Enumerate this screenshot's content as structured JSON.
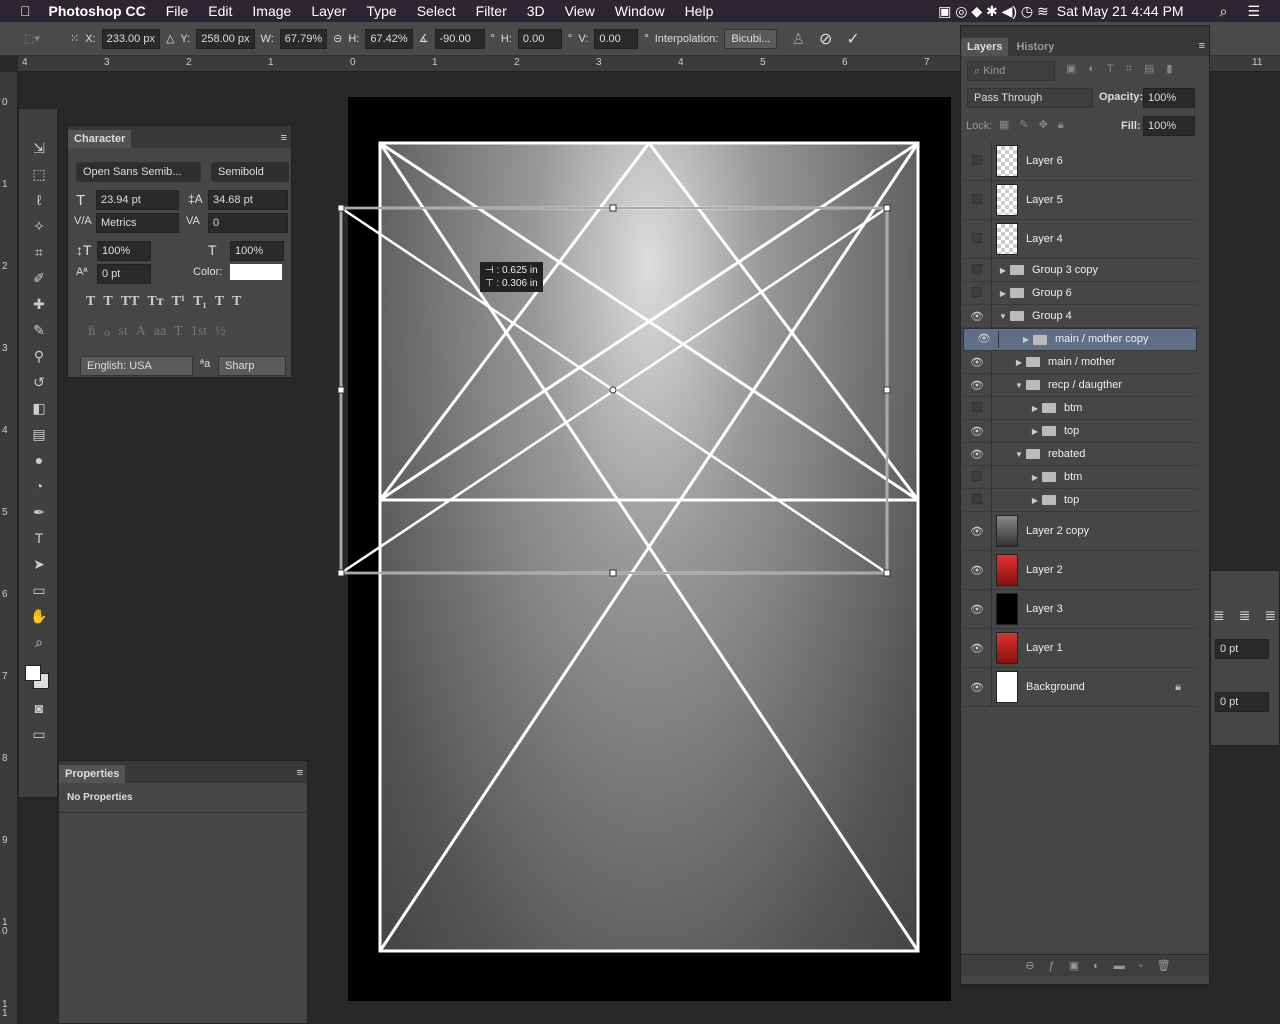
{
  "menubar": {
    "app": "Photoshop CC",
    "items": [
      "File",
      "Edit",
      "Image",
      "Layer",
      "Type",
      "Select",
      "Filter",
      "3D",
      "View",
      "Window",
      "Help"
    ],
    "clock": "Sat May 21  4:44 PM"
  },
  "options": {
    "x_label": "X:",
    "x": "233.00 px",
    "y_label": "Y:",
    "y": "258.00 px",
    "w_label": "W:",
    "w": "67.79%",
    "h_label": "H:",
    "h": "67.42%",
    "angle": "-90.00",
    "hskew_label": "H:",
    "hskew": "0.00",
    "vskew_label": "V:",
    "vskew": "0.00",
    "deg": "°",
    "interp_label": "Interpolation:",
    "interp": "Bicubi..."
  },
  "ruler": {
    "h": [
      "4",
      "3",
      "2",
      "1",
      "0",
      "1",
      "2",
      "3",
      "4",
      "5",
      "6",
      "7"
    ],
    "h_right": "11",
    "v": [
      "0",
      "1",
      "2",
      "3",
      "4",
      "5",
      "6",
      "7",
      "8",
      "9",
      "1\n0",
      "1\n1"
    ]
  },
  "character": {
    "tab": "Character",
    "font": "Open Sans Semib...",
    "style": "Semibold",
    "size": "23.94 pt",
    "leading": "34.68 pt",
    "kerning": "Metrics",
    "tracking": "0",
    "vscale": "100%",
    "hscale": "100%",
    "baseline": "0 pt",
    "color_label": "Color:",
    "color": "#ffffff",
    "styles": [
      "T",
      "T",
      "TT",
      "Tт",
      "T¹",
      "T₁",
      "T",
      "T"
    ],
    "opentype": [
      "ﬁ",
      "ℴ",
      "st",
      "A",
      "aa",
      "T",
      "1st",
      "½"
    ],
    "language": "English: USA",
    "aa_icon": "ªa",
    "antialias": "Sharp"
  },
  "properties": {
    "tab": "Properties",
    "text": "No Properties"
  },
  "tooltip": {
    "line1": "⊣ : 0.625 in",
    "line2": "⊤ : 0.306 in"
  },
  "layers": {
    "tab": "Layers",
    "tab2": "History",
    "kind": "Kind",
    "blend": "Pass Through",
    "opacity_label": "Opacity:",
    "opacity": "100%",
    "lock_label": "Lock:",
    "fill_label": "Fill:",
    "fill": "100%",
    "rows": [
      {
        "name": "Layer 6",
        "visible": false,
        "type": "layer",
        "thumb": "trans",
        "depth": 0
      },
      {
        "name": "Layer 5",
        "visible": false,
        "type": "layer",
        "thumb": "trans",
        "depth": 0
      },
      {
        "name": "Layer 4",
        "visible": false,
        "type": "layer",
        "thumb": "trans",
        "depth": 0
      },
      {
        "name": "Group 3 copy",
        "visible": false,
        "type": "group",
        "open": false,
        "depth": 0
      },
      {
        "name": "Group 6",
        "visible": false,
        "type": "group",
        "open": false,
        "depth": 0
      },
      {
        "name": "Group 4",
        "visible": true,
        "type": "group",
        "open": true,
        "depth": 0
      },
      {
        "name": "main / mother copy",
        "visible": true,
        "type": "group",
        "open": false,
        "depth": 1,
        "selected": true
      },
      {
        "name": "main / mother",
        "visible": true,
        "type": "group",
        "open": false,
        "depth": 1
      },
      {
        "name": "recp / daugther",
        "visible": true,
        "type": "group",
        "open": true,
        "depth": 1
      },
      {
        "name": "btm",
        "visible": false,
        "type": "group",
        "open": false,
        "depth": 2
      },
      {
        "name": "top",
        "visible": true,
        "type": "group",
        "open": false,
        "depth": 2
      },
      {
        "name": "rebated",
        "visible": true,
        "type": "group",
        "open": true,
        "depth": 1
      },
      {
        "name": "btm",
        "visible": false,
        "type": "group",
        "open": false,
        "depth": 2
      },
      {
        "name": "top",
        "visible": false,
        "type": "group",
        "open": false,
        "depth": 2
      },
      {
        "name": "Layer 2 copy",
        "visible": true,
        "type": "layer",
        "thumb": "photo",
        "depth": 0
      },
      {
        "name": "Layer 2",
        "visible": true,
        "type": "layer",
        "thumb": "red",
        "depth": 0
      },
      {
        "name": "Layer 3",
        "visible": true,
        "type": "layer",
        "thumb": "black",
        "depth": 0
      },
      {
        "name": "Layer 1",
        "visible": true,
        "type": "layer",
        "thumb": "red",
        "depth": 0
      },
      {
        "name": "Background",
        "visible": true,
        "type": "layer",
        "thumb": "white",
        "depth": 0,
        "locked": true
      }
    ]
  },
  "right_strip": {
    "field1": "0 pt",
    "field2": "0 pt"
  },
  "colors": {
    "selection": "#5e6f86",
    "menubar": "#2d2530"
  }
}
